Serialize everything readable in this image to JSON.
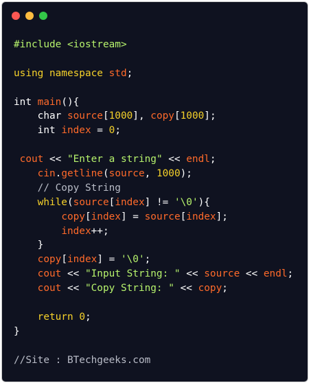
{
  "window": {
    "buttons": [
      {
        "name": "close",
        "color": "#fc5753"
      },
      {
        "name": "minimize",
        "color": "#fdbc40"
      },
      {
        "name": "maximize",
        "color": "#33c748"
      }
    ]
  },
  "colors": {
    "background": "#0f1220",
    "keyword": "#f6d22a",
    "identifier": "#ff6a2a",
    "string": "#b6f26c",
    "comment": "#b9bcc7",
    "plain": "#ffffff"
  },
  "code": {
    "lines": [
      [
        {
          "c": "pre",
          "t": "#include <iostream>"
        }
      ],
      [],
      [
        {
          "c": "kw",
          "t": "using namespace "
        },
        {
          "c": "id",
          "t": "std"
        },
        {
          "c": "pl",
          "t": ";"
        }
      ],
      [],
      [
        {
          "c": "pl",
          "t": "int "
        },
        {
          "c": "id",
          "t": "main"
        },
        {
          "c": "pl",
          "t": "(){"
        }
      ],
      [
        {
          "c": "pl",
          "t": "    char "
        },
        {
          "c": "id",
          "t": "source"
        },
        {
          "c": "pl",
          "t": "["
        },
        {
          "c": "num",
          "t": "1000"
        },
        {
          "c": "pl",
          "t": "], "
        },
        {
          "c": "id",
          "t": "copy"
        },
        {
          "c": "pl",
          "t": "["
        },
        {
          "c": "num",
          "t": "1000"
        },
        {
          "c": "pl",
          "t": "];"
        }
      ],
      [
        {
          "c": "pl",
          "t": "    int "
        },
        {
          "c": "id",
          "t": "index"
        },
        {
          "c": "pl",
          "t": " = "
        },
        {
          "c": "num",
          "t": "0"
        },
        {
          "c": "pl",
          "t": ";"
        }
      ],
      [],
      [
        {
          "c": "pl",
          "t": " "
        },
        {
          "c": "id",
          "t": "cout"
        },
        {
          "c": "pl",
          "t": " << "
        },
        {
          "c": "str",
          "t": "\"Enter a string\""
        },
        {
          "c": "pl",
          "t": " << "
        },
        {
          "c": "id",
          "t": "endl"
        },
        {
          "c": "pl",
          "t": ";"
        }
      ],
      [
        {
          "c": "pl",
          "t": "    "
        },
        {
          "c": "id",
          "t": "cin"
        },
        {
          "c": "pl",
          "t": "."
        },
        {
          "c": "id",
          "t": "getline"
        },
        {
          "c": "pl",
          "t": "("
        },
        {
          "c": "id",
          "t": "source"
        },
        {
          "c": "pl",
          "t": ", "
        },
        {
          "c": "num",
          "t": "1000"
        },
        {
          "c": "pl",
          "t": ");"
        }
      ],
      [
        {
          "c": "cm",
          "t": "    // Copy String"
        }
      ],
      [
        {
          "c": "pl",
          "t": "    "
        },
        {
          "c": "kw",
          "t": "while"
        },
        {
          "c": "pl",
          "t": "("
        },
        {
          "c": "id",
          "t": "source"
        },
        {
          "c": "pl",
          "t": "["
        },
        {
          "c": "id",
          "t": "index"
        },
        {
          "c": "pl",
          "t": "] != "
        },
        {
          "c": "str",
          "t": "'\\0'"
        },
        {
          "c": "pl",
          "t": "){"
        }
      ],
      [
        {
          "c": "pl",
          "t": "        "
        },
        {
          "c": "id",
          "t": "copy"
        },
        {
          "c": "pl",
          "t": "["
        },
        {
          "c": "id",
          "t": "index"
        },
        {
          "c": "pl",
          "t": "] = "
        },
        {
          "c": "id",
          "t": "source"
        },
        {
          "c": "pl",
          "t": "["
        },
        {
          "c": "id",
          "t": "index"
        },
        {
          "c": "pl",
          "t": "];"
        }
      ],
      [
        {
          "c": "pl",
          "t": "        "
        },
        {
          "c": "id",
          "t": "index"
        },
        {
          "c": "pl",
          "t": "++;"
        }
      ],
      [
        {
          "c": "pl",
          "t": "    }"
        }
      ],
      [
        {
          "c": "pl",
          "t": "    "
        },
        {
          "c": "id",
          "t": "copy"
        },
        {
          "c": "pl",
          "t": "["
        },
        {
          "c": "id",
          "t": "index"
        },
        {
          "c": "pl",
          "t": "] = "
        },
        {
          "c": "str",
          "t": "'\\0'"
        },
        {
          "c": "pl",
          "t": ";"
        }
      ],
      [
        {
          "c": "pl",
          "t": "    "
        },
        {
          "c": "id",
          "t": "cout"
        },
        {
          "c": "pl",
          "t": " << "
        },
        {
          "c": "str",
          "t": "\"Input String: \""
        },
        {
          "c": "pl",
          "t": " << "
        },
        {
          "c": "id",
          "t": "source"
        },
        {
          "c": "pl",
          "t": " << "
        },
        {
          "c": "id",
          "t": "endl"
        },
        {
          "c": "pl",
          "t": ";"
        }
      ],
      [
        {
          "c": "pl",
          "t": "    "
        },
        {
          "c": "id",
          "t": "cout"
        },
        {
          "c": "pl",
          "t": " << "
        },
        {
          "c": "str",
          "t": "\"Copy String: \""
        },
        {
          "c": "pl",
          "t": " << "
        },
        {
          "c": "id",
          "t": "copy"
        },
        {
          "c": "pl",
          "t": ";"
        }
      ],
      [],
      [
        {
          "c": "pl",
          "t": "    "
        },
        {
          "c": "kw",
          "t": "return "
        },
        {
          "c": "num",
          "t": "0"
        },
        {
          "c": "pl",
          "t": ";"
        }
      ],
      [
        {
          "c": "pl",
          "t": "}"
        }
      ],
      [],
      [
        {
          "c": "cm",
          "t": "//Site : BTechgeeks.com"
        }
      ]
    ]
  }
}
